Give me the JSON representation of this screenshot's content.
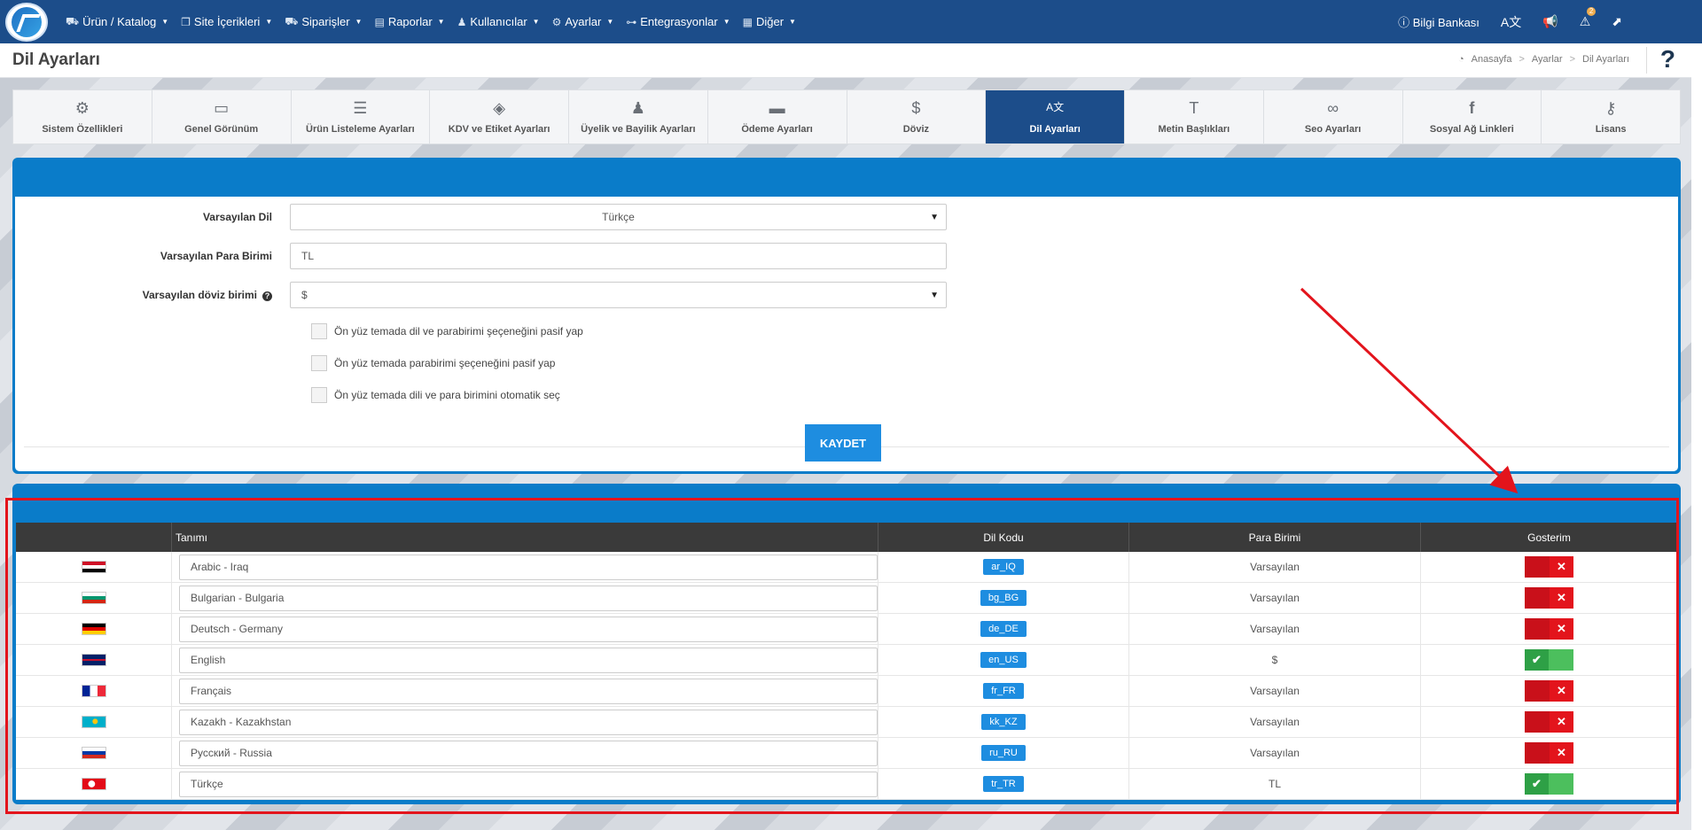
{
  "nav": {
    "items": [
      {
        "label": "Ürün / Katalog",
        "icon": "truck-icon"
      },
      {
        "label": "Site İçerikleri",
        "icon": "copy-icon"
      },
      {
        "label": "Siparişler",
        "icon": "cart-icon"
      },
      {
        "label": "Raporlar",
        "icon": "report-icon"
      },
      {
        "label": "Kullanıcılar",
        "icon": "users-icon"
      },
      {
        "label": "Ayarlar",
        "icon": "gears-icon"
      },
      {
        "label": "Entegrasyonlar",
        "icon": "sitemap-icon"
      },
      {
        "label": "Diğer",
        "icon": "grid-icon"
      }
    ],
    "knowledge_base": "Bilgi Bankası",
    "alerts_count": "2"
  },
  "page": {
    "title": "Dil Ayarları",
    "breadcrumb": [
      "Anasayfa",
      "Ayarlar",
      "Dil Ayarları"
    ],
    "help": "?"
  },
  "tabs": [
    {
      "label": "Sistem Özellikleri",
      "icon": "gears-icon",
      "glyph": "⚙"
    },
    {
      "label": "Genel Görünüm",
      "icon": "monitor-icon",
      "glyph": "▭"
    },
    {
      "label": "Ürün Listeleme Ayarları",
      "icon": "list-icon",
      "glyph": "☰"
    },
    {
      "label": "KDV ve Etiket Ayarları",
      "icon": "tags-icon",
      "glyph": "◈"
    },
    {
      "label": "Üyelik ve Bayilik Ayarları",
      "icon": "users-icon",
      "glyph": "♟"
    },
    {
      "label": "Ödeme Ayarları",
      "icon": "credit-card-icon",
      "glyph": "▬"
    },
    {
      "label": "Döviz",
      "icon": "dollar-icon",
      "glyph": "$"
    },
    {
      "label": "Dil Ayarları",
      "icon": "language-icon",
      "glyph": "A文",
      "active": true
    },
    {
      "label": "Metin Başlıkları",
      "icon": "text-height-icon",
      "glyph": "T"
    },
    {
      "label": "Seo Ayarları",
      "icon": "link-icon",
      "glyph": "∞"
    },
    {
      "label": "Sosyal Ağ Linkleri",
      "icon": "facebook-icon",
      "glyph": "f"
    },
    {
      "label": "Lisans",
      "icon": "key-icon",
      "glyph": "⚷"
    }
  ],
  "form": {
    "default_language_label": "Varsayılan Dil",
    "default_language_value": "Türkçe",
    "default_currency_label": "Varsayılan Para Birimi",
    "default_currency_value": "TL",
    "default_exchange_label": "Varsayılan döviz birimi",
    "default_exchange_value": "$",
    "checkbox1": "Ön yüz temada dil ve parabirimi şeçeneğini pasif yap",
    "checkbox2": "Ön yüz temada parabirimi şeçeneğini pasif yap",
    "checkbox3": "Ön yüz temada dili ve para birimini otomatik seç",
    "save_label": "KAYDET"
  },
  "table": {
    "headers": [
      "",
      "Tanımı",
      "Dil Kodu",
      "Para Birimi",
      "Gosterim"
    ],
    "rows": [
      {
        "flag": "iraq-flag-icon",
        "name": "Arabic - Iraq",
        "code": "ar_IQ",
        "currency": "Varsayılan",
        "shown": false
      },
      {
        "flag": "bulgaria-flag-icon",
        "name": "Bulgarian - Bulgaria",
        "code": "bg_BG",
        "currency": "Varsayılan",
        "shown": false
      },
      {
        "flag": "germany-flag-icon",
        "name": "Deutsch - Germany",
        "code": "de_DE",
        "currency": "Varsayılan",
        "shown": false
      },
      {
        "flag": "uk-flag-icon",
        "name": "English",
        "code": "en_US",
        "currency": "$",
        "shown": true
      },
      {
        "flag": "france-flag-icon",
        "name": "Français",
        "code": "fr_FR",
        "currency": "Varsayılan",
        "shown": false
      },
      {
        "flag": "kazakhstan-flag-icon",
        "name": "Kazakh - Kazakhstan",
        "code": "kk_KZ",
        "currency": "Varsayılan",
        "shown": false
      },
      {
        "flag": "russia-flag-icon",
        "name": "Русский - Russia",
        "code": "ru_RU",
        "currency": "Varsayılan",
        "shown": false
      },
      {
        "flag": "turkey-flag-icon",
        "name": "Türkçe",
        "code": "tr_TR",
        "currency": "TL",
        "shown": true
      }
    ]
  },
  "colors": {
    "nav_bg": "#1c4d8a",
    "panel_blue": "#0a7cc9",
    "accent_blue": "#1e8de0",
    "toggle_off": "#e3141c",
    "toggle_on": "#2ea046",
    "annotation_red": "#e3141c"
  }
}
